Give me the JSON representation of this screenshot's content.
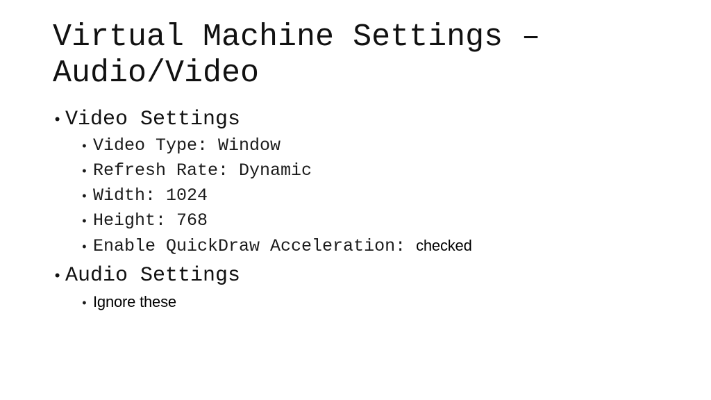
{
  "slide": {
    "background_color": "#ffffff",
    "text_color": "#111111",
    "title": "Virtual Machine Settings – Audio/Video",
    "title_line_1": "Virtual Machine Settings –",
    "title_line_2": "Audio/Video",
    "bullet_glyph": "•",
    "content": [
      {
        "level": 1,
        "text": "Video Settings",
        "font": "mono"
      },
      {
        "level": 2,
        "text": "Video Type: Window",
        "font": "mono"
      },
      {
        "level": 2,
        "text": "Refresh Rate: Dynamic",
        "font": "mono"
      },
      {
        "level": 2,
        "text": "Width: 1024",
        "font": "mono"
      },
      {
        "level": 2,
        "text": "Height: 768",
        "font": "mono"
      },
      {
        "level": 2,
        "text": "Enable QuickDraw Acceleration: ",
        "text_sans_suffix": "checked",
        "font": "mono+sans"
      },
      {
        "level": 1,
        "text": "Audio Settings",
        "font": "mono"
      },
      {
        "level": 2,
        "text": "Ignore these",
        "font": "sans"
      }
    ]
  }
}
